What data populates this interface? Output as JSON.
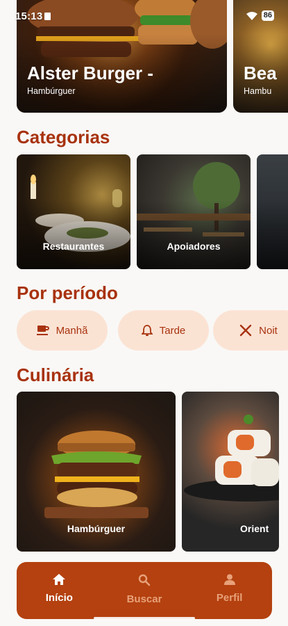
{
  "status_bar": {
    "time": "15:13",
    "battery": "86"
  },
  "hero": [
    {
      "title": "Alster Burger -",
      "subtitle": "Hambúrguer"
    },
    {
      "title": "Bea",
      "subtitle": "Hambu"
    }
  ],
  "sections": {
    "categories": "Categorias",
    "period": "Por período",
    "cuisine": "Culinária"
  },
  "categories": [
    {
      "label": "Restaurantes"
    },
    {
      "label": "Apoiadores"
    },
    {
      "label": ""
    }
  ],
  "periods": [
    {
      "label": "Manhã",
      "icon": "coffee-icon"
    },
    {
      "label": "Tarde",
      "icon": "bell-icon"
    },
    {
      "label": "Noit",
      "icon": "utensils-icon"
    }
  ],
  "cuisines": [
    {
      "label": "Hambúrguer"
    },
    {
      "label": "Orient"
    }
  ],
  "nav": [
    {
      "label": "Início",
      "icon": "home-icon",
      "active": true
    },
    {
      "label": "Buscar",
      "icon": "search-icon",
      "active": false
    },
    {
      "label": "Perfil",
      "icon": "person-icon",
      "active": false
    }
  ],
  "colors": {
    "accent": "#a8320e",
    "nav_bg": "#b4410f",
    "pill_bg": "#fbe3d4",
    "nav_inactive": "#e8a17a",
    "background": "#f9f8f6"
  }
}
